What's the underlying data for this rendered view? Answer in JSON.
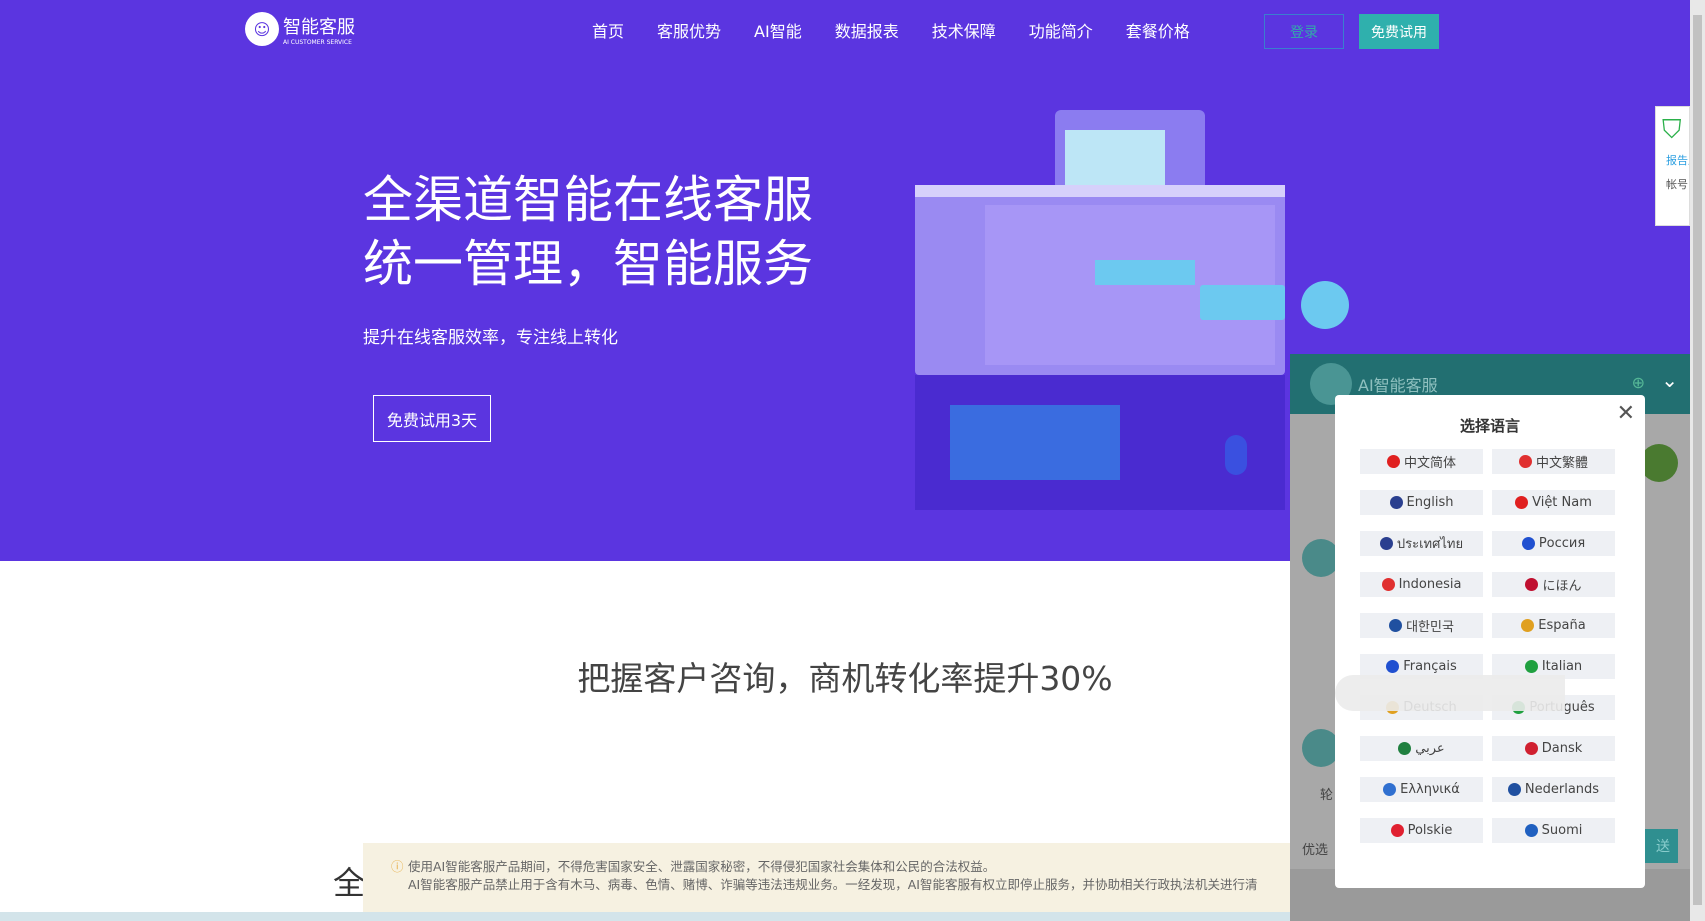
{
  "header": {
    "logo_text": "智能客服",
    "logo_sub": "AI CUSTOMER SERVICE",
    "nav": [
      "首页",
      "客服优势",
      "AI智能",
      "数据报表",
      "技术保障",
      "功能简介",
      "套餐价格"
    ],
    "login": "登录",
    "trial": "免费试用"
  },
  "hero": {
    "title_line1": "全渠道智能在线客服",
    "title_line2": "统一管理，智能服务",
    "subtitle": "提升在线客服效率，专注线上转化",
    "cta": "免费试用3天"
  },
  "section": {
    "title": "把握客户咨询，商机转化率提升30%",
    "partial": "全"
  },
  "notice": {
    "line1": "使用AI智能客服产品期间，不得危害国家安全、泄露国家秘密，不得侵犯国家社会集体和公民的合法权益。",
    "line2": "AI智能客服产品禁止用于含有木马、病毒、色情、赌博、诈骗等违法违规业务。一经发现，AI智能客服有权立即停止服务，并协助相关行政执法机关进行清"
  },
  "chat": {
    "title": "AI智能客服",
    "send": "送",
    "input_hint": "优选",
    "chip": "轮"
  },
  "modal": {
    "title": "选择语言",
    "languages": [
      {
        "label": "中文简体",
        "color": "#e02020"
      },
      {
        "label": "中文繁體",
        "color": "#e03030"
      },
      {
        "label": "English",
        "color": "#2a3f8f"
      },
      {
        "label": "Việt Nam",
        "color": "#e02020"
      },
      {
        "label": "ประเทศไทย",
        "color": "#2a3f8f"
      },
      {
        "label": "Россия",
        "color": "#2050d0"
      },
      {
        "label": "Indonesia",
        "color": "#e03030"
      },
      {
        "label": "にほん",
        "color": "#c01030"
      },
      {
        "label": "대한민국",
        "color": "#2050a0"
      },
      {
        "label": "España",
        "color": "#e0a020"
      },
      {
        "label": "Français",
        "color": "#2050d0"
      },
      {
        "label": "Italian",
        "color": "#20a040"
      },
      {
        "label": "Deutsch",
        "color": "#e0a020"
      },
      {
        "label": "Português",
        "color": "#20a040"
      },
      {
        "label": "عربي",
        "color": "#208040"
      },
      {
        "label": "Dansk",
        "color": "#d02030"
      },
      {
        "label": "Ελληνικά",
        "color": "#3070d0"
      },
      {
        "label": "Nederlands",
        "color": "#2050a0"
      },
      {
        "label": "Polskie",
        "color": "#e02030"
      },
      {
        "label": "Suomi",
        "color": "#2060c0"
      }
    ]
  },
  "security": {
    "text": "报告风险",
    "account": "帐号"
  },
  "colors": {
    "hero": "#5b35e0",
    "teal": "#2fb0ad",
    "chat_head": "#226f71"
  }
}
